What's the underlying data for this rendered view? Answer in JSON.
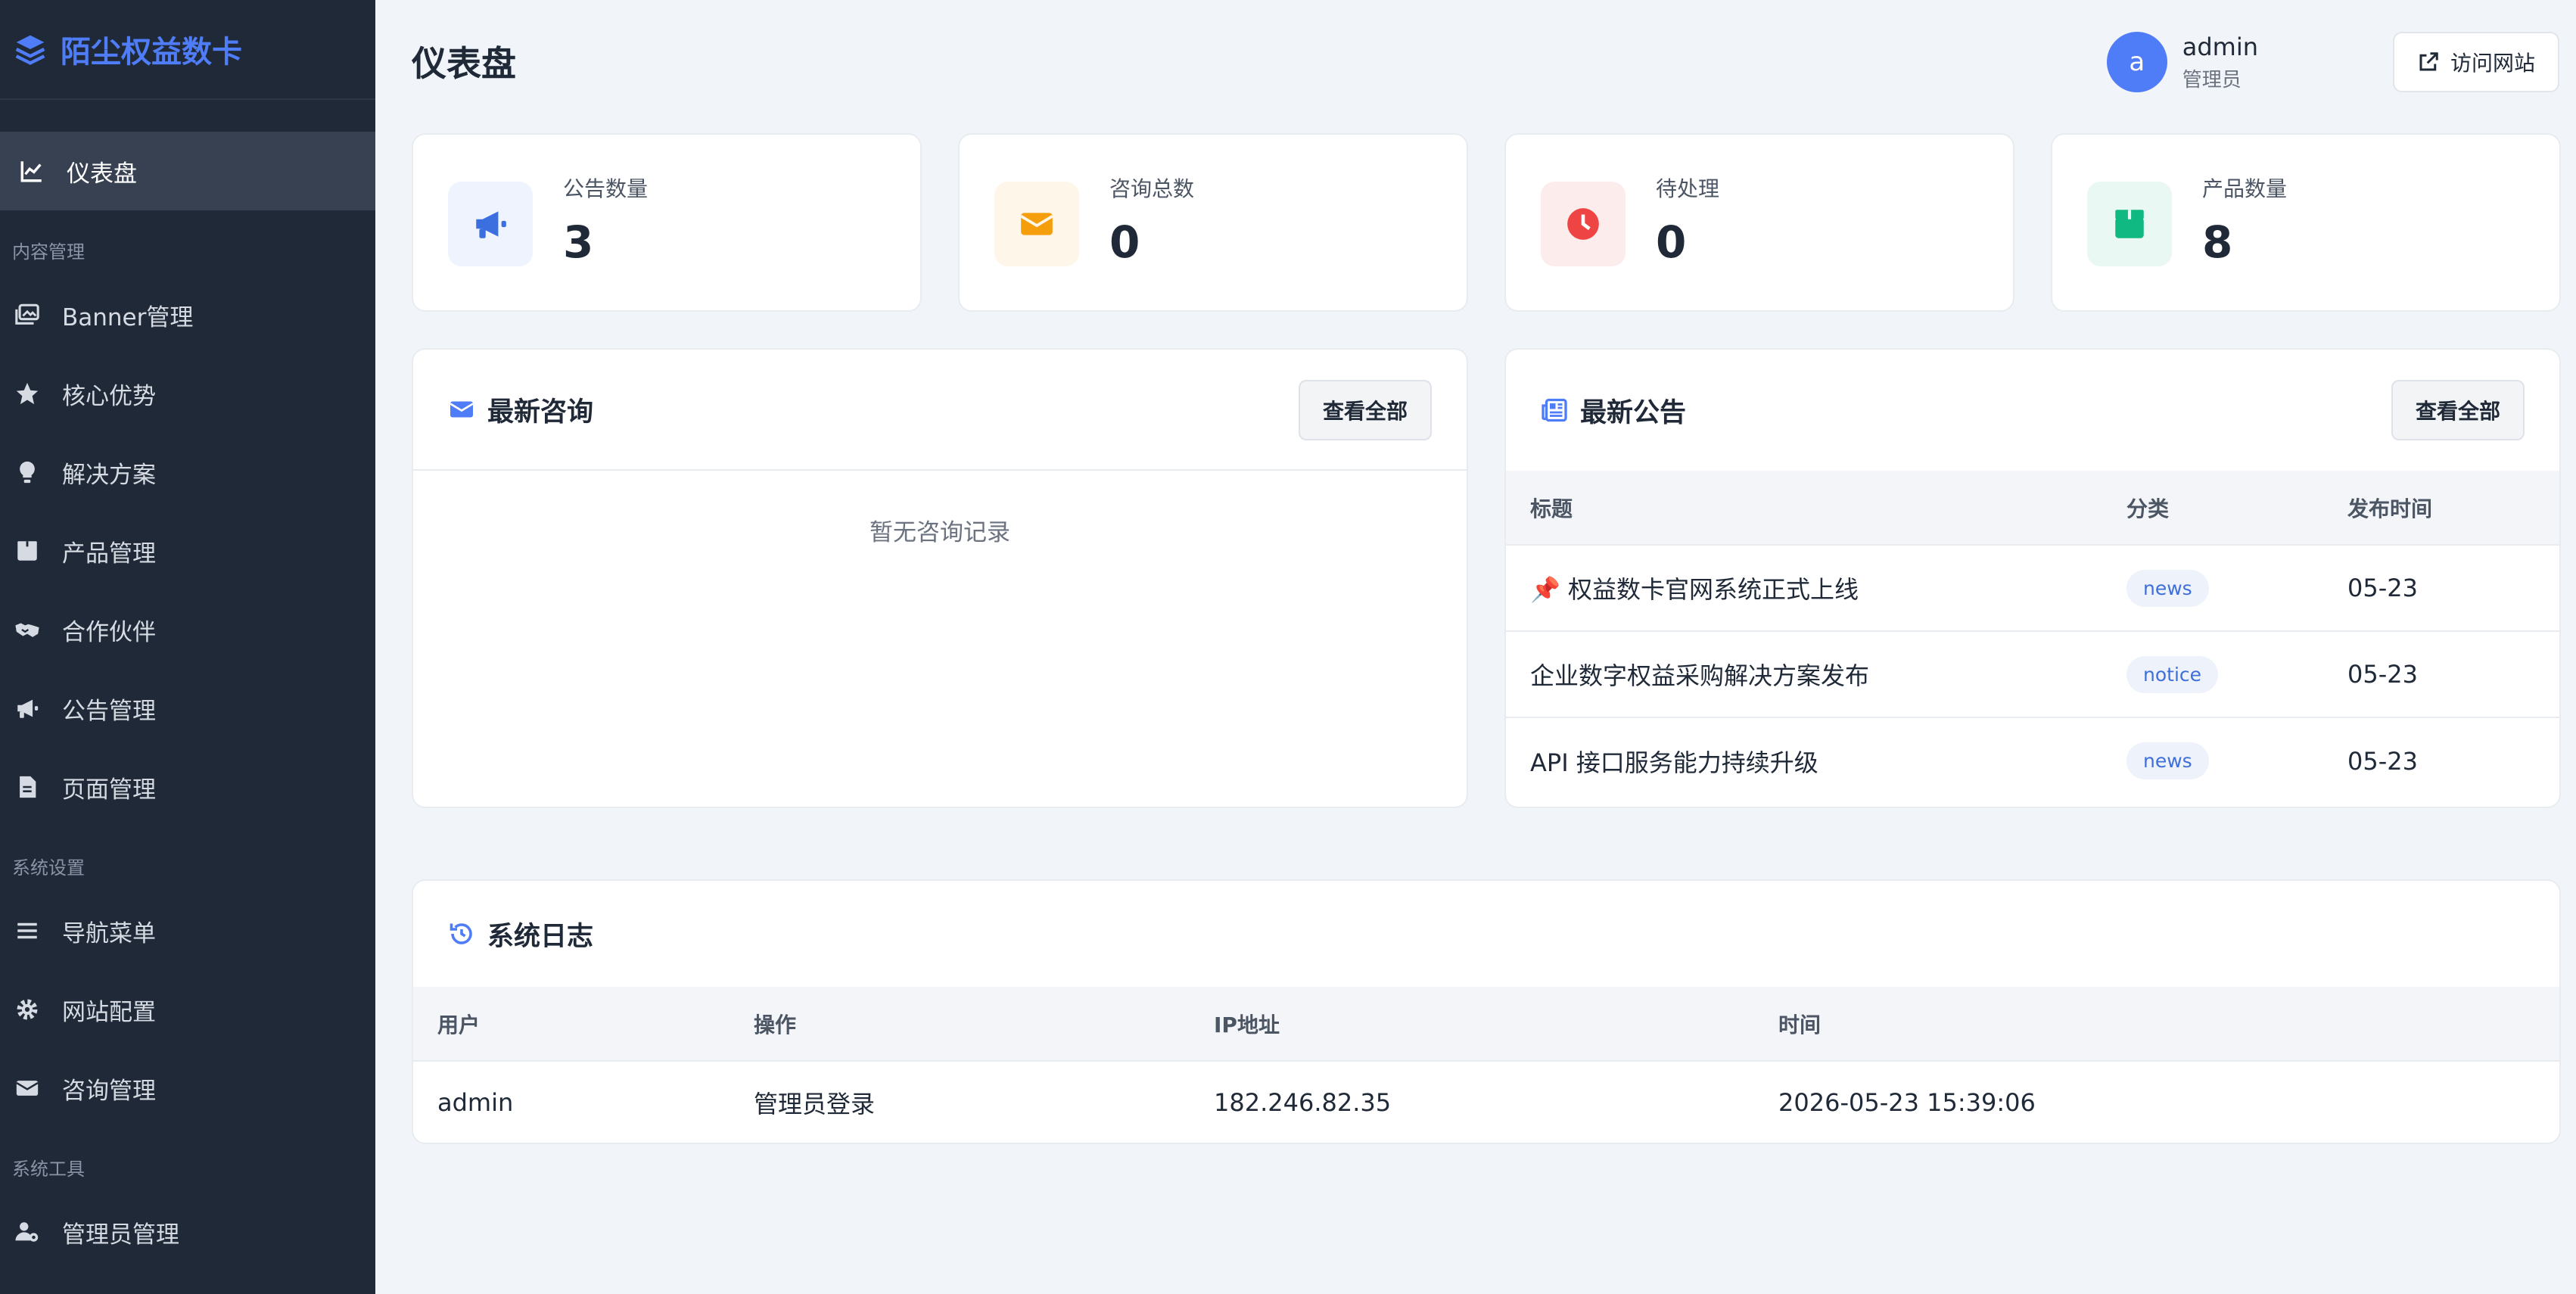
{
  "brand": {
    "name": "陌尘权益数卡"
  },
  "sidebar": {
    "active": {
      "label": "仪表盘"
    },
    "groups": [
      {
        "title": "内容管理",
        "items": [
          "Banner管理",
          "核心优势",
          "解决方案",
          "产品管理",
          "合作伙伴",
          "公告管理",
          "页面管理"
        ]
      },
      {
        "title": "系统设置",
        "items": [
          "导航菜单",
          "网站配置",
          "咨询管理"
        ]
      },
      {
        "title": "系统工具",
        "items": [
          "管理员管理"
        ]
      }
    ]
  },
  "header": {
    "title": "仪表盘",
    "user": {
      "avatar_letter": "a",
      "name": "admin",
      "role": "管理员"
    },
    "visit_label": "访问网站"
  },
  "stats": [
    {
      "label": "公告数量",
      "value": "3",
      "color": "#3b6fe0",
      "bg": "#eef3fe"
    },
    {
      "label": "咨询总数",
      "value": "0",
      "color": "#f59e0b",
      "bg": "#fff6ea"
    },
    {
      "label": "待处理",
      "value": "0",
      "color": "#ef4444",
      "bg": "#fdecec"
    },
    {
      "label": "产品数量",
      "value": "8",
      "color": "#10b981",
      "bg": "#e9f8f2"
    }
  ],
  "inquiries": {
    "title": "最新咨询",
    "view_all": "查看全部",
    "empty": "暂无咨询记录"
  },
  "announcements": {
    "title": "最新公告",
    "view_all": "查看全部",
    "columns": [
      "标题",
      "分类",
      "发布时间"
    ],
    "rows": [
      {
        "pin": "📌",
        "title": "权益数卡官网系统正式上线",
        "category": "news",
        "date": "05-23"
      },
      {
        "pin": "",
        "title": "企业数字权益采购解决方案发布",
        "category": "notice",
        "date": "05-23"
      },
      {
        "pin": "",
        "title": "API 接口服务能力持续升级",
        "category": "news",
        "date": "05-23"
      }
    ]
  },
  "logs": {
    "title": "系统日志",
    "columns": [
      "用户",
      "操作",
      "IP地址",
      "时间"
    ],
    "rows": [
      {
        "user": "admin",
        "action": "管理员登录",
        "ip": "182.246.82.35",
        "time": "2026-05-23 15:39:06"
      }
    ]
  }
}
